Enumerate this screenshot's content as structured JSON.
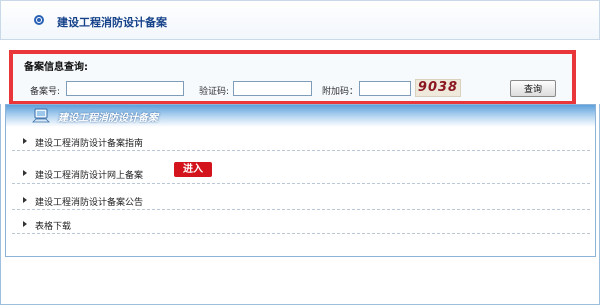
{
  "header": {
    "title": "建设工程消防设计备案"
  },
  "query": {
    "title": "备案信息查询:",
    "record_no_label": "备案号:",
    "verify_code_label": "验证码:",
    "extra_code_label": "附加码：",
    "captcha_text": "9038",
    "button_label": "查询",
    "record_no_value": "",
    "verify_code_value": "",
    "extra_code_value": ""
  },
  "section": {
    "title": "建设工程消防设计备案",
    "items": [
      {
        "label": "建设工程消防设计备案指南"
      },
      {
        "label": "建设工程消防设计网上备案",
        "badge": "进入"
      },
      {
        "label": "建设工程消防设计备案公告"
      },
      {
        "label": "表格下载"
      }
    ]
  },
  "colors": {
    "highlight_border": "#e8363b",
    "title_blue": "#16428a",
    "badge_red": "#d4141c",
    "captcha_red": "#8b1820"
  }
}
